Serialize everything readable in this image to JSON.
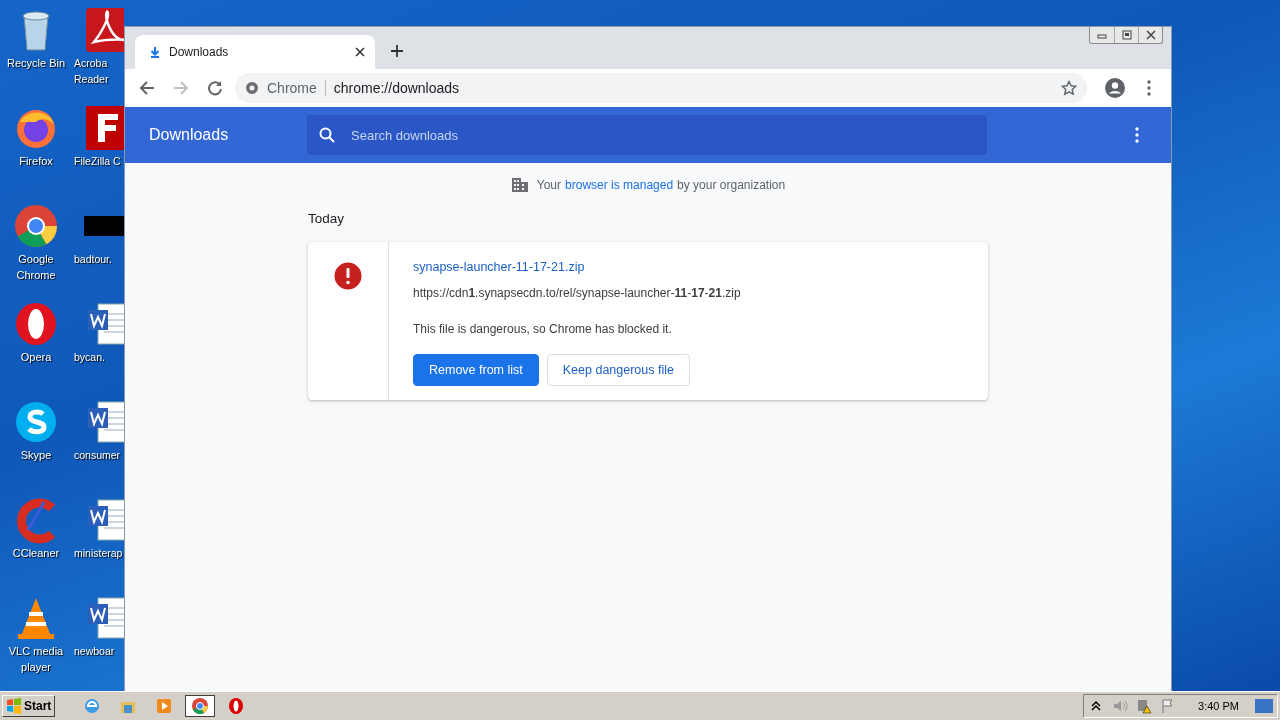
{
  "desktop": {
    "icons": [
      {
        "kind": "recycle",
        "lines": [
          "Recycle Bin"
        ]
      },
      {
        "kind": "acrobat",
        "lines": [
          "Acroba",
          "Reader"
        ]
      },
      {
        "kind": "firefox",
        "lines": [
          "Firefox"
        ]
      },
      {
        "kind": "filezilla",
        "lines": [
          "FileZilla C"
        ]
      },
      {
        "kind": "chrome",
        "lines": [
          "Google",
          "Chrome"
        ]
      },
      {
        "kind": "redacted",
        "lines": [
          "badtour."
        ]
      },
      {
        "kind": "opera",
        "lines": [
          "Opera"
        ]
      },
      {
        "kind": "word",
        "lines": [
          "bycan."
        ]
      },
      {
        "kind": "skype",
        "lines": [
          "Skype"
        ]
      },
      {
        "kind": "word",
        "lines": [
          "consumer"
        ]
      },
      {
        "kind": "ccleaner",
        "lines": [
          "CCleaner"
        ]
      },
      {
        "kind": "word",
        "lines": [
          "ministerap"
        ]
      },
      {
        "kind": "vlc",
        "lines": [
          "VLC media",
          "player"
        ]
      },
      {
        "kind": "word",
        "lines": [
          "newboar"
        ]
      }
    ]
  },
  "browser": {
    "tabs": [
      {
        "title": "Downloads",
        "selected": true
      }
    ],
    "omnibox": {
      "chip": "Chrome",
      "url": "chrome://downloads"
    },
    "page": {
      "title": "Downloads",
      "search": {
        "placeholder": "Search downloads"
      },
      "notice": {
        "before": "Your",
        "link": "browser is managed",
        "after": "by your organization"
      },
      "section": "Today",
      "items": [
        {
          "filename": "synapse-launcher-11-17-21.zip",
          "url": "https://cdn**1**.synapsecdn.to/rel/synapse-launcher-**11**-**17**-**21**.zip",
          "status": "This file is dangerous, so Chrome has blocked it.",
          "dangerous": true,
          "buttons": [
            {
              "label": "Remove from list",
              "kind": "primary"
            },
            {
              "label": "Keep dangerous file",
              "kind": "secondary"
            }
          ]
        }
      ]
    }
  },
  "taskbar": {
    "start": "Start",
    "apps": [
      {
        "kind": "ie",
        "selected": false
      },
      {
        "kind": "explorer",
        "selected": false
      },
      {
        "kind": "media",
        "selected": false
      },
      {
        "kind": "chrome",
        "selected": true
      },
      {
        "kind": "opera",
        "selected": false
      }
    ],
    "tray": [
      {
        "kind": "chevron"
      },
      {
        "kind": "speaker"
      },
      {
        "kind": "network"
      },
      {
        "kind": "flag"
      }
    ],
    "clock": "3:40 PM"
  }
}
